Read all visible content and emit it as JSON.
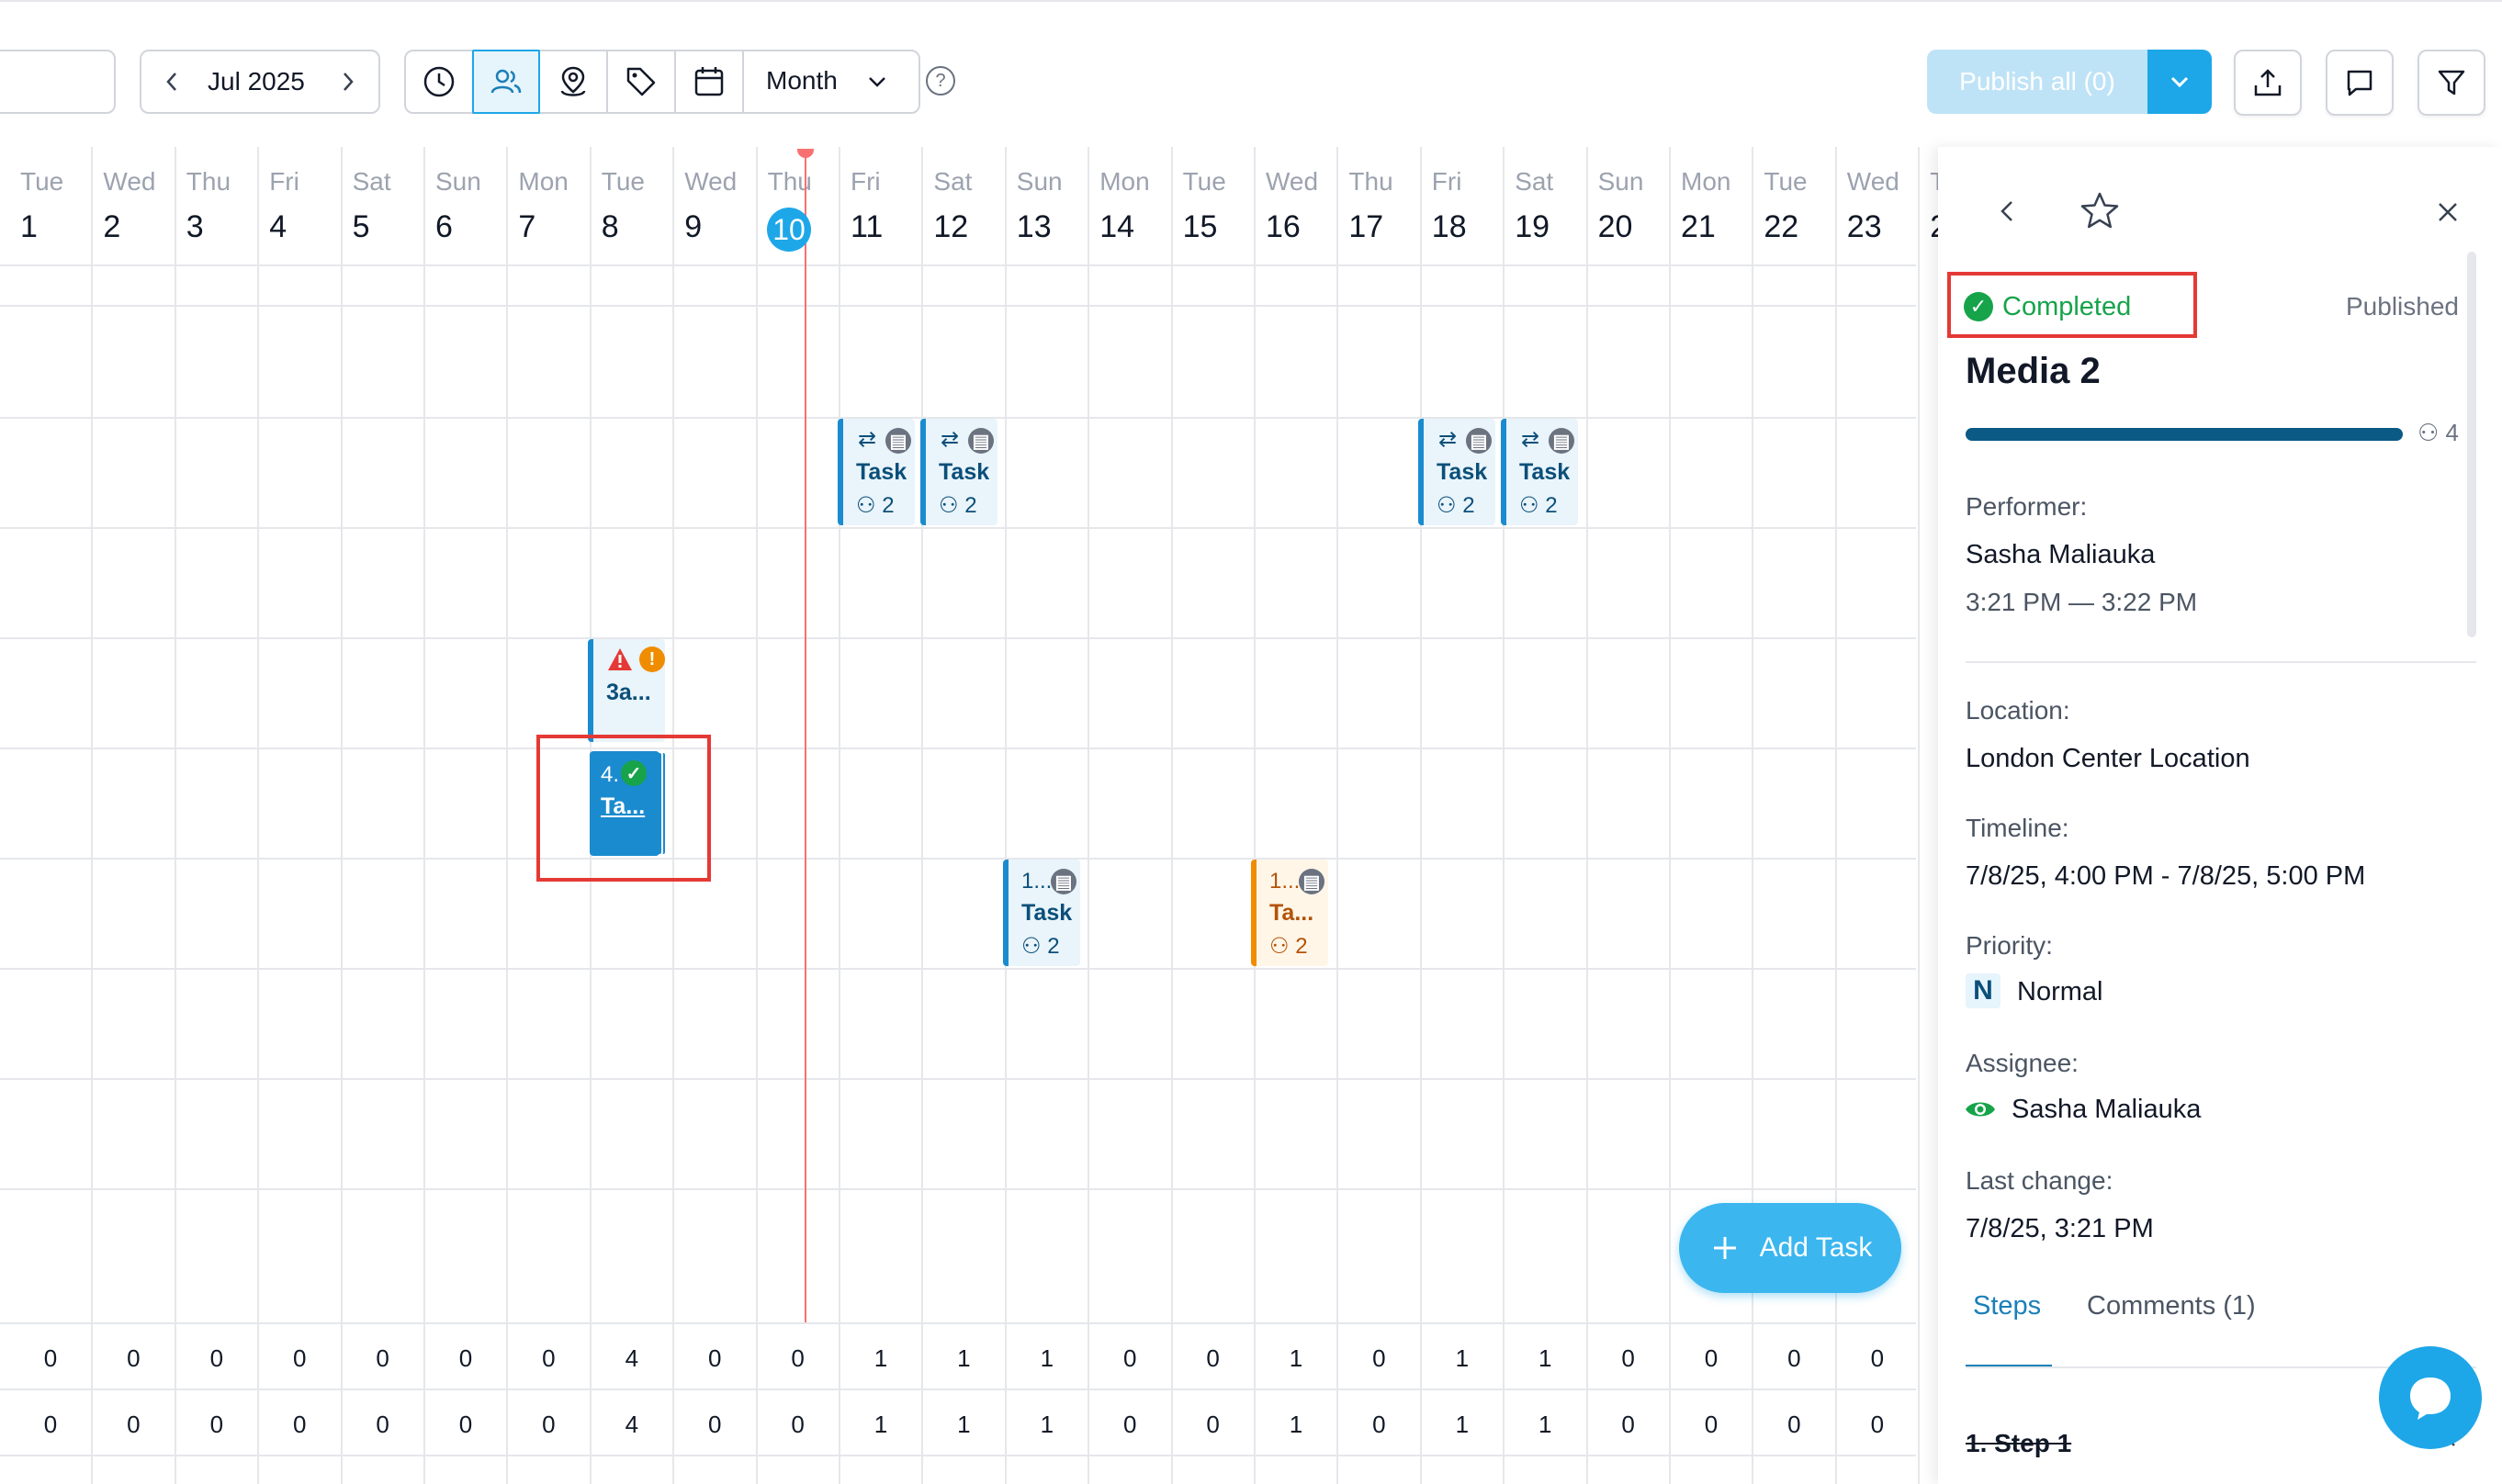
{
  "toolbar": {
    "month_label": "Jul 2025",
    "view_select": "Month",
    "publish_label": "Publish all (0)"
  },
  "calendar": {
    "days": [
      {
        "dow": "Tue",
        "num": "1"
      },
      {
        "dow": "Wed",
        "num": "2"
      },
      {
        "dow": "Thu",
        "num": "3"
      },
      {
        "dow": "Fri",
        "num": "4"
      },
      {
        "dow": "Sat",
        "num": "5"
      },
      {
        "dow": "Sun",
        "num": "6"
      },
      {
        "dow": "Mon",
        "num": "7"
      },
      {
        "dow": "Tue",
        "num": "8"
      },
      {
        "dow": "Wed",
        "num": "9"
      },
      {
        "dow": "Thu",
        "num": "10"
      },
      {
        "dow": "Fri",
        "num": "11"
      },
      {
        "dow": "Sat",
        "num": "12"
      },
      {
        "dow": "Sun",
        "num": "13"
      },
      {
        "dow": "Mon",
        "num": "14"
      },
      {
        "dow": "Tue",
        "num": "15"
      },
      {
        "dow": "Wed",
        "num": "16"
      },
      {
        "dow": "Thu",
        "num": "17"
      },
      {
        "dow": "Fri",
        "num": "18"
      },
      {
        "dow": "Sat",
        "num": "19"
      },
      {
        "dow": "Sun",
        "num": "20"
      },
      {
        "dow": "Mon",
        "num": "21"
      },
      {
        "dow": "Tue",
        "num": "22"
      },
      {
        "dow": "Wed",
        "num": "23"
      },
      {
        "dow": "T",
        "num": "2"
      }
    ],
    "today_num": "10",
    "tasks": {
      "fri11": {
        "title": "Task",
        "count": "2"
      },
      "sat12": {
        "title": "Task",
        "count": "2"
      },
      "fri18": {
        "title": "Task",
        "count": "2"
      },
      "sat19": {
        "title": "Task",
        "count": "2"
      },
      "tue8_top": {
        "title": "3a..."
      },
      "tue8_sel": {
        "num": "4.",
        "title": "Ta..."
      },
      "sun13": {
        "num": "1...",
        "title": "Task",
        "count": "2"
      },
      "wed16": {
        "num": "1...",
        "title": "Ta...",
        "count": "2"
      }
    },
    "count_rows": [
      [
        "0",
        "0",
        "0",
        "0",
        "0",
        "0",
        "0",
        "4",
        "0",
        "0",
        "1",
        "1",
        "1",
        "0",
        "0",
        "1",
        "0",
        "1",
        "1",
        "0",
        "0",
        "0",
        "0"
      ],
      [
        "0",
        "0",
        "0",
        "0",
        "0",
        "0",
        "0",
        "4",
        "0",
        "0",
        "1",
        "1",
        "1",
        "0",
        "0",
        "1",
        "0",
        "1",
        "1",
        "0",
        "0",
        "0",
        "0"
      ]
    ],
    "add_task_label": "Add Task"
  },
  "panel": {
    "status": "Completed",
    "published": "Published",
    "title": "Media 2",
    "progress_fraction": 1.0,
    "progress_count": "4",
    "performer_label": "Performer:",
    "performer": "Sasha Maliauka",
    "time_range": "3:21 PM — 3:22 PM",
    "location_label": "Location:",
    "location": "London Center Location",
    "timeline_label": "Timeline:",
    "timeline": "7/8/25, 4:00 PM - 7/8/25, 5:00 PM",
    "priority_label": "Priority:",
    "priority_badge": "N",
    "priority": "Normal",
    "assignee_label": "Assignee:",
    "assignee": "Sasha Maliauka",
    "last_change_label": "Last change:",
    "last_change": "7/8/25, 3:21 PM",
    "tab_steps": "Steps",
    "tab_comments": "Comments (1)",
    "step1": "1. Step 1"
  },
  "colors": {
    "accent": "#1ea7e8",
    "completed": "#16a34a",
    "today_line": "#f87171",
    "highlight": "#e53935"
  }
}
